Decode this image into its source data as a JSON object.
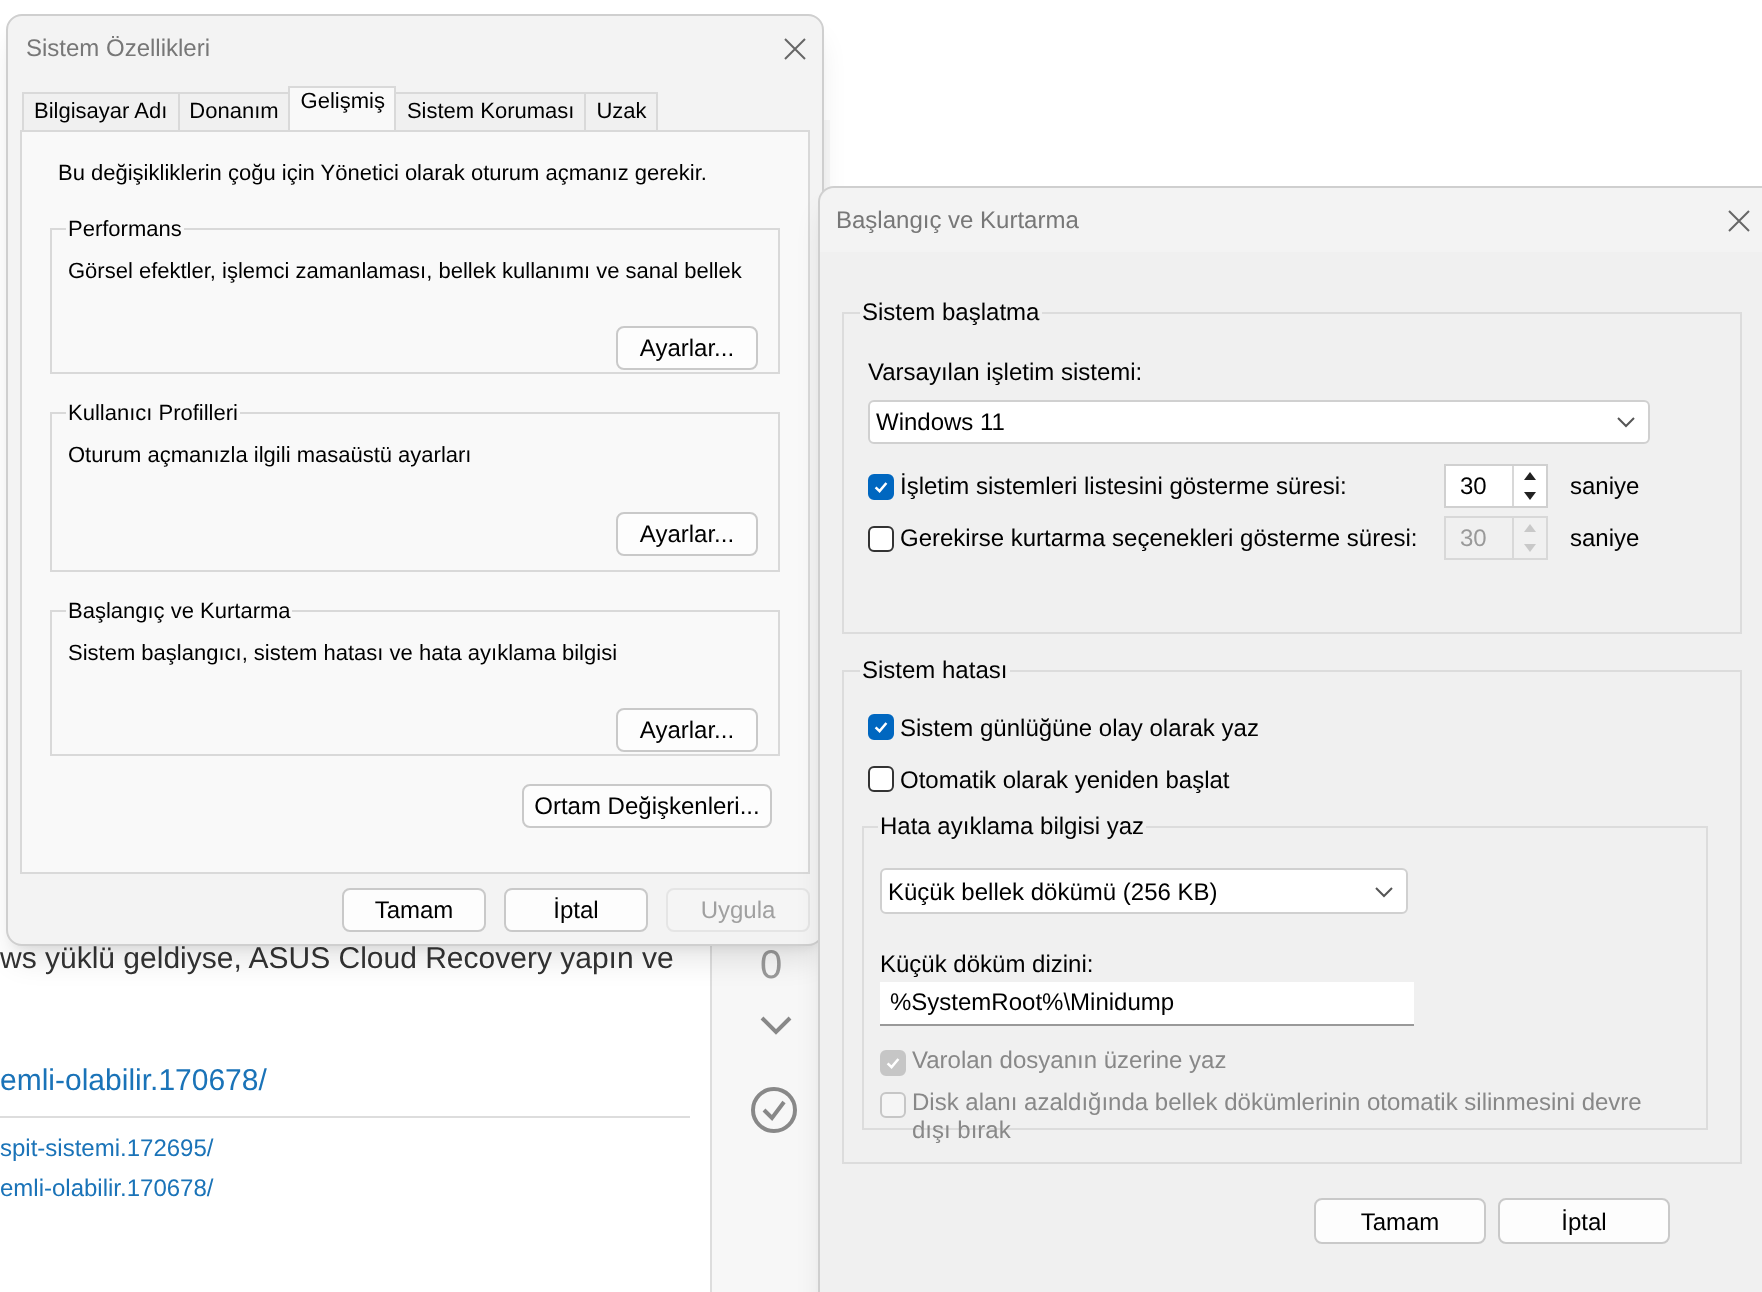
{
  "background_page": {
    "body_text": "ws yüklü geldiyse, ASUS Cloud Recovery yapın ve",
    "main_link": "emli-olabilir.170678/",
    "links": [
      "spit-sistemi.172695/",
      "emli-olabilir.170678/"
    ],
    "vote_count": "0"
  },
  "system_properties": {
    "title": "Sistem Özellikleri",
    "tabs": [
      {
        "label": "Bilgisayar Adı",
        "selected": false
      },
      {
        "label": "Donanım",
        "selected": false
      },
      {
        "label": "Gelişmiş",
        "selected": true
      },
      {
        "label": "Sistem Koruması",
        "selected": false
      },
      {
        "label": "Uzak",
        "selected": false
      }
    ],
    "notice": "Bu değişikliklerin çoğu için Yönetici olarak oturum açmanız gerekir.",
    "groups": [
      {
        "title": "Performans",
        "description": "Görsel efektler, işlemci zamanlaması, bellek kullanımı ve sanal bellek",
        "button": "Ayarlar..."
      },
      {
        "title": "Kullanıcı Profilleri",
        "description": "Oturum açmanızla ilgili masaüstü ayarları",
        "button": "Ayarlar..."
      },
      {
        "title": "Başlangıç ve Kurtarma",
        "description": "Sistem başlangıcı, sistem hatası ve hata ayıklama bilgisi",
        "button": "Ayarlar..."
      }
    ],
    "env_button": "Ortam Değişkenleri...",
    "buttons": [
      {
        "label": "Tamam",
        "disabled": false
      },
      {
        "label": "İptal",
        "disabled": false
      },
      {
        "label": "Uygula",
        "disabled": true
      }
    ]
  },
  "startup_recovery": {
    "title": "Başlangıç ve Kurtarma",
    "startup": {
      "title": "Sistem başlatma",
      "default_os_label": "Varsayılan işletim sistemi:",
      "default_os_value": "Windows 11",
      "options": [
        {
          "label": "İşletim sistemleri listesini gösterme süresi:",
          "checked": true,
          "value": "30",
          "value_disabled": false,
          "unit": "saniye"
        },
        {
          "label": "Gerekirse kurtarma seçenekleri gösterme süresi:",
          "checked": false,
          "value": "30",
          "value_disabled": true,
          "unit": "saniye"
        }
      ]
    },
    "failure": {
      "title": "Sistem hatası",
      "checks": [
        {
          "label": "Sistem günlüğüne olay olarak yaz",
          "checked": true
        },
        {
          "label": "Otomatik olarak yeniden başlat",
          "checked": false
        }
      ],
      "debug": {
        "title": "Hata ayıklama bilgisi yaz",
        "type_value": "Küçük bellek dökümü (256 KB)",
        "dir_label": "Küçük döküm dizini:",
        "dir_value": "%SystemRoot%\\Minidump",
        "checks": [
          {
            "label": "Varolan dosyanın üzerine yaz",
            "checked": true,
            "disabled": true
          },
          {
            "label": "Disk alanı azaldığında bellek dökümlerinin otomatik silinmesini devre dışı bırak",
            "checked": false,
            "disabled": true
          }
        ]
      }
    },
    "buttons": [
      "Tamam",
      "İptal"
    ]
  }
}
